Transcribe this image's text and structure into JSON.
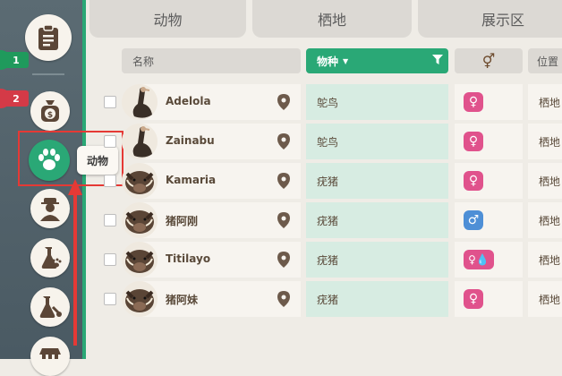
{
  "sidebar": {
    "badges": [
      "1",
      "2"
    ],
    "tooltip": "动物"
  },
  "tabs": [
    "动物",
    "栖地",
    "展示区"
  ],
  "table": {
    "headers": {
      "name": "名称",
      "species": "物种",
      "gender_icon": "⚥",
      "location": "位置"
    },
    "rows": [
      {
        "name": "Adelola",
        "species": "鸵鸟",
        "gender": "♀",
        "location": "栖地",
        "avatar": "ostrich"
      },
      {
        "name": "Zainabu",
        "species": "鸵鸟",
        "gender": "♀",
        "location": "栖地",
        "avatar": "ostrich"
      },
      {
        "name": "Kamaria",
        "species": "疣猪",
        "gender": "♀",
        "location": "栖地",
        "avatar": "warthog"
      },
      {
        "name": "猪阿刚",
        "species": "疣猪",
        "gender": "♂",
        "location": "栖地",
        "avatar": "warthog"
      },
      {
        "name": "Titilayo",
        "species": "疣猪",
        "gender": "♀💧",
        "location": "栖地",
        "avatar": "warthog"
      },
      {
        "name": "猪阿妹",
        "species": "疣猪",
        "gender": "♀",
        "location": "栖地",
        "avatar": "warthog"
      }
    ]
  },
  "colors": {
    "accent": "#2aa876",
    "female": "#e0528c",
    "male": "#4e8fd6",
    "alert": "#d43a47"
  }
}
